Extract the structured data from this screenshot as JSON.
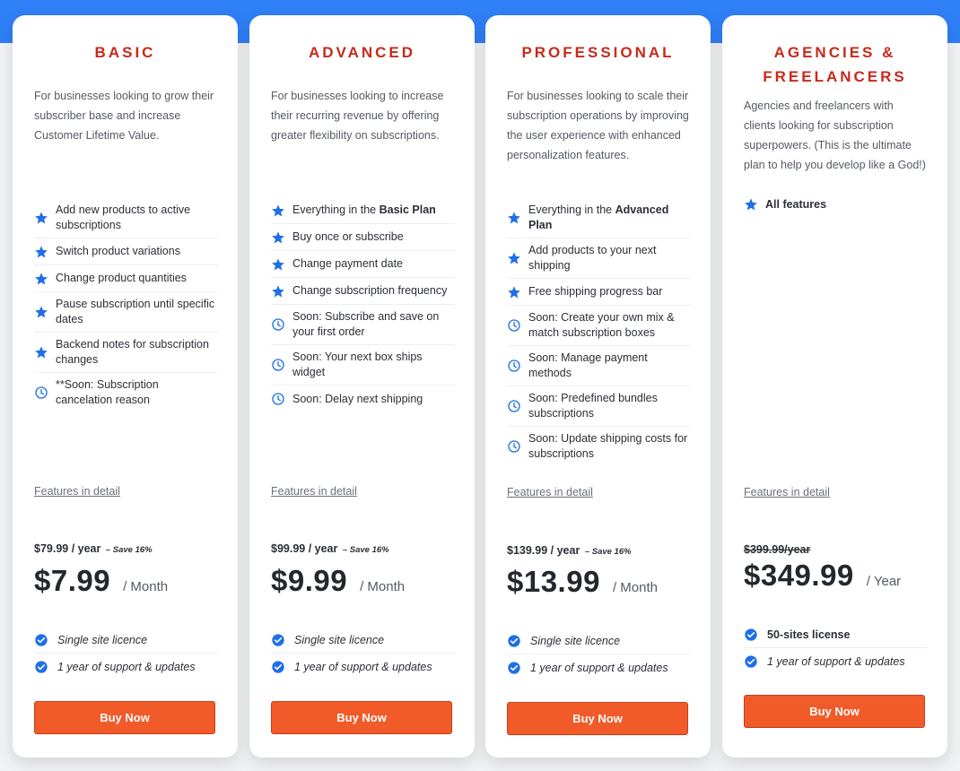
{
  "plans": [
    {
      "title": "BASIC",
      "description": "For businesses looking to grow their subscriber base and increase Customer Lifetime Value.",
      "features": [
        {
          "icon": "star-icon",
          "text": "Add new products to active subscriptions"
        },
        {
          "icon": "star-icon",
          "text": "Switch product variations"
        },
        {
          "icon": "star-icon",
          "text": "Change product quantities"
        },
        {
          "icon": "star-icon",
          "text": "Pause subscription until specific dates"
        },
        {
          "icon": "star-icon",
          "text": "Backend notes for subscription changes"
        },
        {
          "icon": "clock-icon",
          "text": "**Soon: Subscription cancelation reason"
        }
      ],
      "details_link": "Features in detail",
      "yearly_price": "$79.99 / year",
      "save_note": "– Save 16%",
      "price": "$7.99",
      "period": "/ Month",
      "bottom_features": [
        "Single site licence",
        "1 year of support & updates"
      ],
      "button": "Buy Now"
    },
    {
      "title": "ADVANCED",
      "description": "For businesses looking to increase their recurring revenue by offering greater flexibility on subscriptions.",
      "features": [
        {
          "icon": "star-icon",
          "text": "Everything in the ",
          "bold": "Basic Plan"
        },
        {
          "icon": "star-icon",
          "text": "Buy once or subscribe"
        },
        {
          "icon": "star-icon",
          "text": "Change payment date"
        },
        {
          "icon": "star-icon",
          "text": "Change subscription frequency"
        },
        {
          "icon": "clock-icon",
          "text": "Soon: Subscribe and save on your first order"
        },
        {
          "icon": "clock-icon",
          "text": "Soon: Your next box ships widget"
        },
        {
          "icon": "clock-icon",
          "text": "Soon: Delay next shipping"
        }
      ],
      "details_link": "Features in detail",
      "yearly_price": "$99.99 / year",
      "save_note": "– Save 16%",
      "price": "$9.99",
      "period": "/ Month",
      "bottom_features": [
        "Single site licence",
        "1 year of support & updates"
      ],
      "button": "Buy Now"
    },
    {
      "title": "PROFESSIONAL",
      "description": "For businesses looking to scale their subscription operations by improving the user experience with enhanced personalization features.",
      "features": [
        {
          "icon": "star-icon",
          "text": "Everything in the ",
          "bold": "Advanced Plan"
        },
        {
          "icon": "star-icon",
          "text": "Add products to your next shipping"
        },
        {
          "icon": "star-icon",
          "text": "Free shipping progress bar"
        },
        {
          "icon": "clock-icon",
          "text": "Soon: Create your own mix & match subscription boxes"
        },
        {
          "icon": "clock-icon",
          "text": "Soon: Manage payment methods"
        },
        {
          "icon": "clock-icon",
          "text": "Soon: Predefined bundles subscriptions"
        },
        {
          "icon": "clock-icon",
          "text": "Soon: Update shipping costs for subscriptions"
        }
      ],
      "details_link": "Features in detail",
      "yearly_price": "$139.99 / year",
      "save_note": "– Save 16%",
      "price": "$13.99",
      "period": "/ Month",
      "bottom_features": [
        "Single site licence",
        "1 year of support & updates"
      ],
      "button": "Buy Now"
    },
    {
      "title": "AGENCIES & FREELANCERS",
      "description": "Agencies and freelancers with clients looking for subscription superpowers. (This is the ultimate plan to help you develop like a God!)",
      "features": [
        {
          "icon": "star-icon",
          "text": "",
          "bold": "All features"
        }
      ],
      "details_link": "Features in detail",
      "yearly_price": "$399.99/year",
      "price": "$349.99",
      "period": "/ Year",
      "bottom_features": [
        "50-sites license",
        "1 year of support & updates"
      ],
      "button": "Buy Now"
    }
  ],
  "colors": {
    "accent_blue": "#2f7ff6",
    "title_red": "#c8291c",
    "button_orange": "#f15a29"
  }
}
